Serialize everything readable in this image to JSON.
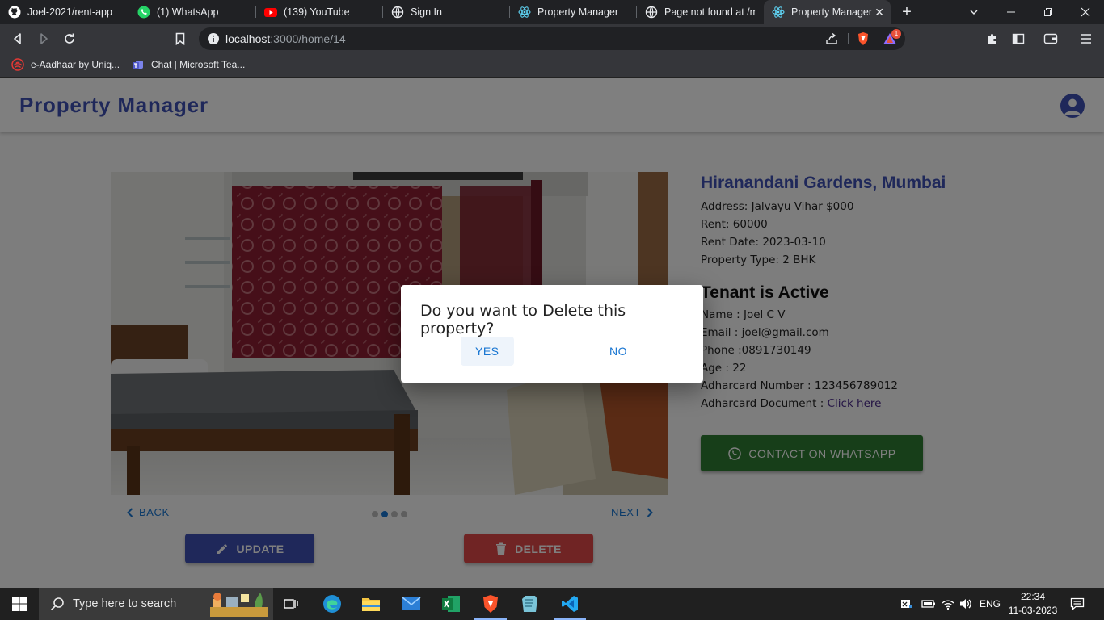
{
  "browser": {
    "tabs": [
      {
        "title": "Joel-2021/rent-app",
        "icon": "github-icon"
      },
      {
        "title": "(1) WhatsApp",
        "icon": "whatsapp-icon"
      },
      {
        "title": "(139) YouTube",
        "icon": "youtube-icon"
      },
      {
        "title": "Sign In",
        "icon": "globe-icon"
      },
      {
        "title": "Property Manager",
        "icon": "react-icon"
      },
      {
        "title": "Page not found at /me",
        "icon": "globe-icon"
      },
      {
        "title": "Property Manager",
        "icon": "react-icon",
        "active": true
      }
    ],
    "url_host": "localhost",
    "url_path": ":3000/home/14",
    "brave_badge": "1",
    "bookmarks": [
      {
        "label": "e-Aadhaar by Uniq...",
        "icon": "aadhaar-icon"
      },
      {
        "label": "Chat | Microsoft Tea...",
        "icon": "teams-icon"
      }
    ]
  },
  "app": {
    "brand": "Property Manager",
    "carousel": {
      "back_label": "BACK",
      "next_label": "NEXT",
      "slide_count": 4,
      "active_slide": 2
    },
    "update_label": "UPDATE",
    "delete_label": "DELETE",
    "property": {
      "title": "Hiranandani Gardens, Mumbai",
      "address": "Address: Jalvayu Vihar $000",
      "rent": "Rent: 60000",
      "rent_date": "Rent Date: 2023-03-10",
      "type": "Property Type: 2 BHK"
    },
    "tenant": {
      "heading": "Tenant is Active",
      "name": "Name : Joel C V",
      "email": "Email : joel@gmail.com",
      "phone": "Phone :0891730149",
      "age": "Age : 22",
      "aadhar_number": "Adharcard Number : 123456789012",
      "aadhar_doc_label": "Adharcard Document : ",
      "aadhar_doc_link": "Click here"
    },
    "whatsapp_label": "CONTACT ON WHATSAPP",
    "dialog": {
      "title": "Do you want to Delete this property?",
      "yes": "YES",
      "no": "NO"
    }
  },
  "taskbar": {
    "search_placeholder": "Type here to search",
    "language": "ENG",
    "time": "22:34",
    "date": "11-03-2023"
  },
  "colors": {
    "primary": "#3f51b5",
    "delete": "#e04848",
    "whatsapp": "#2e7d32",
    "link": "#1976d2"
  }
}
